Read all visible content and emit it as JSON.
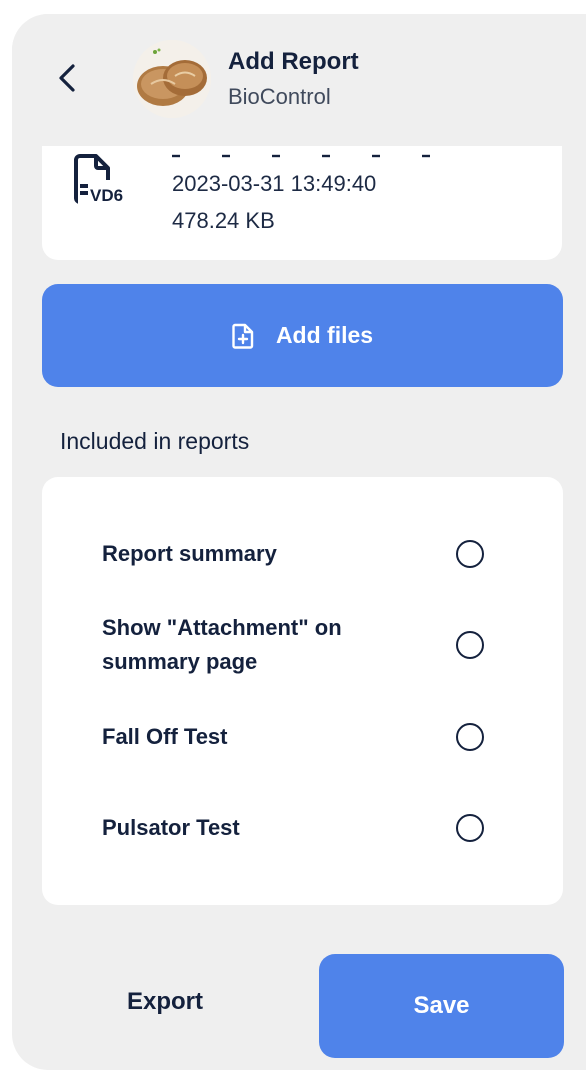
{
  "header": {
    "title": "Add Report",
    "subtitle": "BioControl",
    "back_icon": "chevron-left-icon",
    "avatar_icon": "bread-image"
  },
  "file": {
    "icon": "document-icon",
    "icon_badge": "VD6",
    "date": "2023-03-31 13:49:40",
    "size": "478.24 KB"
  },
  "add_files": {
    "label": "Add files",
    "icon": "file-plus-icon"
  },
  "included": {
    "title": "Included in reports",
    "options": [
      {
        "line1": "Report summary",
        "line2": "",
        "selected": false
      },
      {
        "line1": "Show \"Attachment\" on",
        "line2": "summary page",
        "selected": false
      },
      {
        "line1": "Fall Off Test",
        "line2": "",
        "selected": false
      },
      {
        "line1": "Pulsator Test",
        "line2": "",
        "selected": false
      }
    ]
  },
  "footer": {
    "export_label": "Export",
    "save_label": "Save"
  },
  "colors": {
    "accent": "#4f83ea",
    "background": "#efefef",
    "card": "#ffffff",
    "text": "#14213d"
  }
}
